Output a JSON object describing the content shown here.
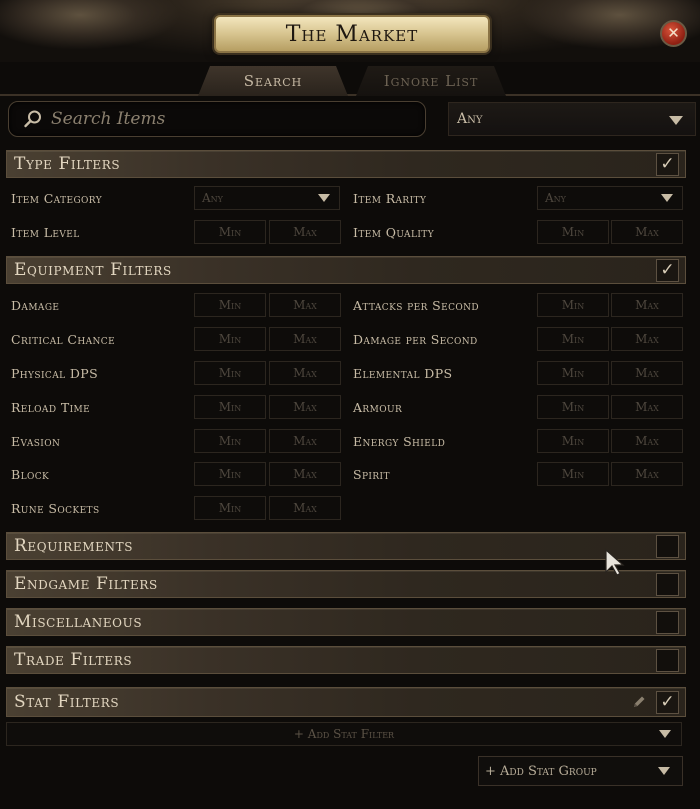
{
  "window": {
    "title": "The Market"
  },
  "tabs": [
    {
      "label": "Search",
      "active": true
    },
    {
      "label": "Ignore List",
      "active": false
    }
  ],
  "search": {
    "placeholder": "Search Items",
    "category_select": "Any"
  },
  "sections": {
    "type_filters": {
      "label": "Type Filters",
      "checked": true,
      "rows": [
        {
          "left": {
            "label": "Item Category",
            "kind": "select",
            "value": "Any"
          },
          "right": {
            "label": "Item Rarity",
            "kind": "select",
            "value": "Any"
          }
        },
        {
          "left": {
            "label": "Item Level",
            "kind": "range",
            "min": "Min",
            "max": "Max"
          },
          "right": {
            "label": "Item Quality",
            "kind": "range",
            "min": "Min",
            "max": "Max"
          }
        }
      ]
    },
    "equipment_filters": {
      "label": "Equipment Filters",
      "checked": true,
      "rows": [
        {
          "left": {
            "label": "Damage",
            "min": "Min",
            "max": "Max"
          },
          "right": {
            "label": "Attacks per Second",
            "min": "Min",
            "max": "Max"
          }
        },
        {
          "left": {
            "label": "Critical Chance",
            "min": "Min",
            "max": "Max"
          },
          "right": {
            "label": "Damage per Second",
            "min": "Min",
            "max": "Max"
          }
        },
        {
          "left": {
            "label": "Physical DPS",
            "min": "Min",
            "max": "Max"
          },
          "right": {
            "label": "Elemental DPS",
            "min": "Min",
            "max": "Max"
          }
        },
        {
          "left": {
            "label": "Reload Time",
            "min": "Min",
            "max": "Max"
          },
          "right": {
            "label": "Armour",
            "min": "Min",
            "max": "Max"
          }
        },
        {
          "left": {
            "label": "Evasion",
            "min": "Min",
            "max": "Max"
          },
          "right": {
            "label": "Energy Shield",
            "min": "Min",
            "max": "Max"
          }
        },
        {
          "left": {
            "label": "Block",
            "min": "Min",
            "max": "Max"
          },
          "right": {
            "label": "Spirit",
            "min": "Min",
            "max": "Max"
          }
        },
        {
          "left": {
            "label": "Rune Sockets",
            "min": "Min",
            "max": "Max"
          }
        }
      ]
    },
    "requirements": {
      "label": "Requirements",
      "checked": false
    },
    "endgame_filters": {
      "label": "Endgame Filters",
      "checked": false
    },
    "miscellaneous": {
      "label": "Miscellaneous",
      "checked": false
    },
    "trade_filters": {
      "label": "Trade Filters",
      "checked": false
    },
    "stat_filters": {
      "label": "Stat Filters",
      "checked": true,
      "add_stat_filter": "+ Add Stat Filter",
      "add_stat_group": "+ Add Stat Group"
    }
  },
  "icons": {
    "close": "close-icon",
    "search": "search-icon",
    "check": "check-icon",
    "pencil": "pencil-icon",
    "chevron": "chevron-down-icon"
  },
  "colors": {
    "background": "#0d0b09",
    "title_plate": "#d7c48f",
    "close_button": "#b8311f",
    "text": "#c9bda7",
    "muted_text": "#4e473e",
    "section_bar": "#3a3127"
  }
}
